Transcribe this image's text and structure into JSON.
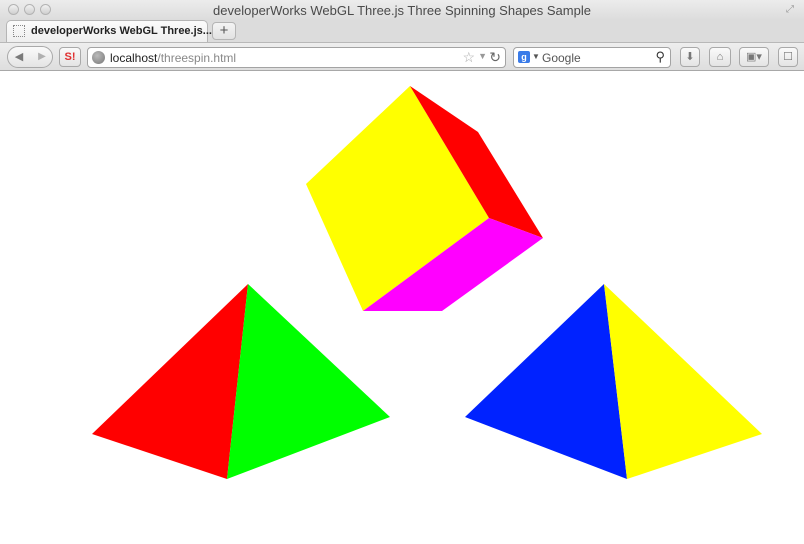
{
  "window": {
    "title": "developerWorks WebGL Three.js Three Spinning Shapes Sample"
  },
  "tabs": [
    {
      "label": "developerWorks WebGL Three.js..."
    }
  ],
  "toolbar": {
    "new_tab_label": "+",
    "url_host": "localhost",
    "url_path": "/threespin.html",
    "search_placeholder": "Google",
    "search_engine_icon": "google-icon"
  },
  "scene": {
    "shapes": [
      {
        "name": "cube",
        "face_colors": [
          "#ffff00",
          "#ff0000",
          "#ff00ff"
        ]
      },
      {
        "name": "pyramid-left",
        "face_colors": [
          "#ff0000",
          "#00ff00"
        ]
      },
      {
        "name": "pyramid-right",
        "face_colors": [
          "#0022ff",
          "#ffff00"
        ]
      }
    ]
  }
}
